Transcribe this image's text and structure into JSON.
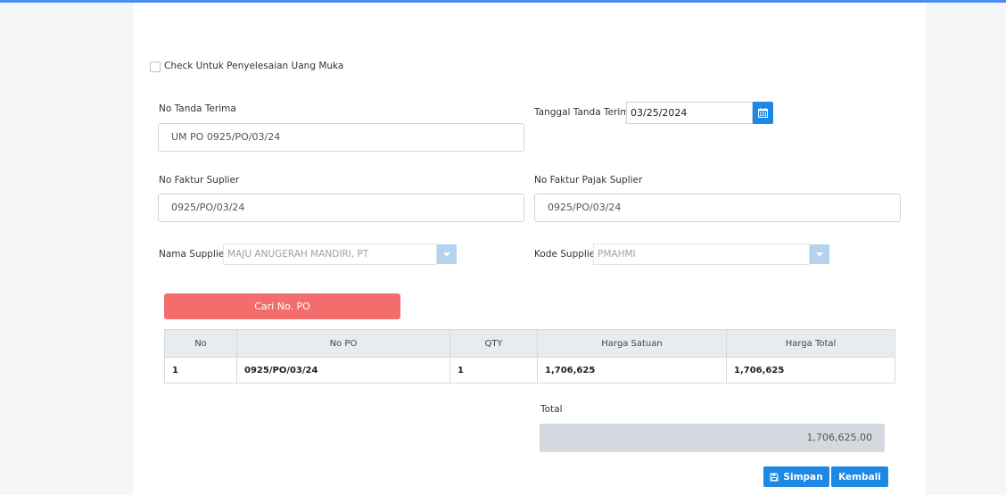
{
  "form": {
    "checkbox_label": "Check Untuk Penyelesaian Uang Muka",
    "no_tanda_terima_label": "No Tanda Terima",
    "no_tanda_terima_value": "UM PO 0925/PO/03/24",
    "tanggal_label": "Tanggal Tanda Terima",
    "tanggal_value": "03/25/2024",
    "no_faktur_label": "No Faktur Suplier",
    "no_faktur_value": "0925/PO/03/24",
    "no_faktur_pajak_label": "No Faktur Pajak Suplier",
    "no_faktur_pajak_value": "0925/PO/03/24",
    "nama_supplier_label": "Nama Supplier",
    "nama_supplier_value": "MAJU ANUGERAH MANDIRI, PT",
    "kode_supplier_label": "Kode Supplier",
    "kode_supplier_value": "PMAHMI"
  },
  "search_button_label": "Cari No. PO",
  "table": {
    "headers": [
      "No",
      "No PO",
      "QTY",
      "Harga Satuan",
      "Harga Total"
    ],
    "rows": [
      [
        "1",
        "0925/PO/03/24",
        "1",
        "1,706,625",
        "1,706,625"
      ]
    ]
  },
  "total": {
    "label": "Total",
    "value": "1,706,625.00"
  },
  "actions": {
    "save_label": "Simpan",
    "back_label": "Kembali"
  },
  "colors": {
    "accent": "#1e88e5",
    "search_button": "#f46d6d",
    "top_bar": "#4a8ff0"
  }
}
